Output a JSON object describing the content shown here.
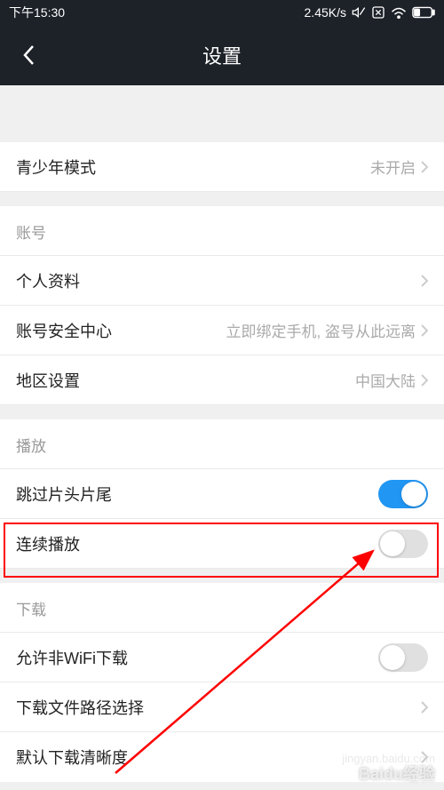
{
  "statusBar": {
    "time": "下午15:30",
    "speed": "2.45K/s"
  },
  "header": {
    "title": "设置"
  },
  "rows": {
    "youthMode": {
      "label": "青少年模式",
      "value": "未开启"
    },
    "accountSection": "账号",
    "profile": {
      "label": "个人资料"
    },
    "security": {
      "label": "账号安全中心",
      "value": "立即绑定手机, 盗号从此远离"
    },
    "region": {
      "label": "地区设置",
      "value": "中国大陆"
    },
    "playSection": "播放",
    "skipIntro": {
      "label": "跳过片头片尾"
    },
    "continuousPlay": {
      "label": "连续播放"
    },
    "downloadSection": "下载",
    "nonWifiDownload": {
      "label": "允许非WiFi下载"
    },
    "downloadPath": {
      "label": "下载文件路径选择"
    },
    "defaultQuality": {
      "label": "默认下载清晰度"
    }
  },
  "watermark": "Baidu经验"
}
